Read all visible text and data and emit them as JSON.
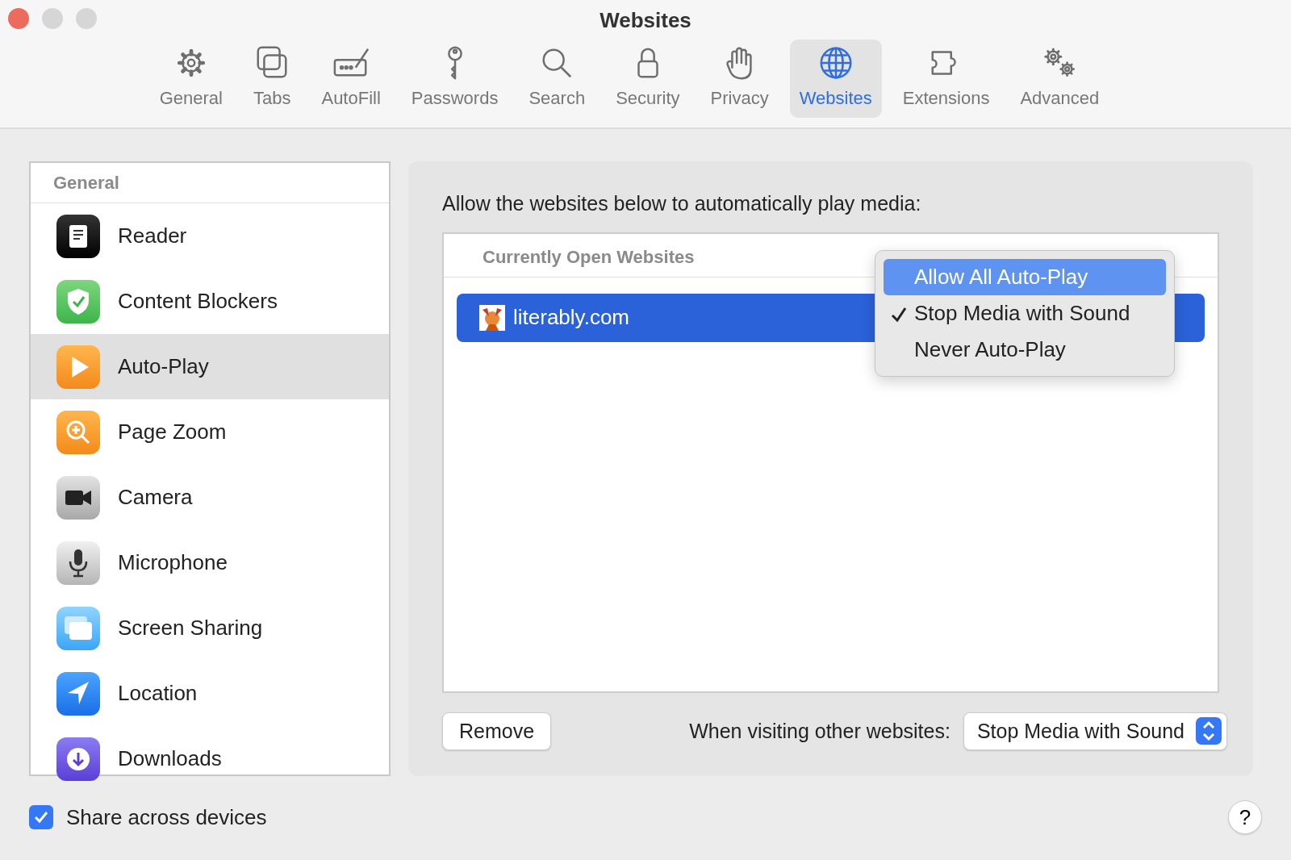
{
  "window": {
    "title": "Websites"
  },
  "toolbar": [
    {
      "label": "General",
      "kind": "gear",
      "selected": false
    },
    {
      "label": "Tabs",
      "kind": "tabs",
      "selected": false
    },
    {
      "label": "AutoFill",
      "kind": "autofill",
      "selected": false
    },
    {
      "label": "Passwords",
      "kind": "key",
      "selected": false
    },
    {
      "label": "Search",
      "kind": "search",
      "selected": false
    },
    {
      "label": "Security",
      "kind": "lock",
      "selected": false
    },
    {
      "label": "Privacy",
      "kind": "hand",
      "selected": false
    },
    {
      "label": "Websites",
      "kind": "globe",
      "selected": true
    },
    {
      "label": "Extensions",
      "kind": "puzzle",
      "selected": false
    },
    {
      "label": "Advanced",
      "kind": "gears",
      "selected": false
    }
  ],
  "sidebar": {
    "header": "General",
    "items": [
      {
        "label": "Reader",
        "kind": "reader",
        "selected": false
      },
      {
        "label": "Content Blockers",
        "kind": "shield",
        "selected": false
      },
      {
        "label": "Auto-Play",
        "kind": "play",
        "selected": true
      },
      {
        "label": "Page Zoom",
        "kind": "zoom",
        "selected": false
      },
      {
        "label": "Camera",
        "kind": "camera",
        "selected": false
      },
      {
        "label": "Microphone",
        "kind": "mic",
        "selected": false
      },
      {
        "label": "Screen Sharing",
        "kind": "screens",
        "selected": false
      },
      {
        "label": "Location",
        "kind": "location",
        "selected": false
      },
      {
        "label": "Downloads",
        "kind": "download",
        "selected": false
      }
    ]
  },
  "panel": {
    "prompt": "Allow the websites below to automatically play media:",
    "table": {
      "header": "Currently Open Websites",
      "rows": [
        {
          "site": "literably.com",
          "selected": true
        }
      ]
    },
    "popup_menu": [
      {
        "label": "Allow All Auto-Play",
        "checked": false,
        "selected": true
      },
      {
        "label": "Stop Media with Sound",
        "checked": true,
        "selected": false
      },
      {
        "label": "Never Auto-Play",
        "checked": false,
        "selected": false
      }
    ],
    "remove_button": "Remove",
    "default_label": "When visiting other websites:",
    "default_select": "Stop Media with Sound"
  },
  "share_checkbox": {
    "label": "Share across devices",
    "checked": true
  },
  "help_button": "?"
}
